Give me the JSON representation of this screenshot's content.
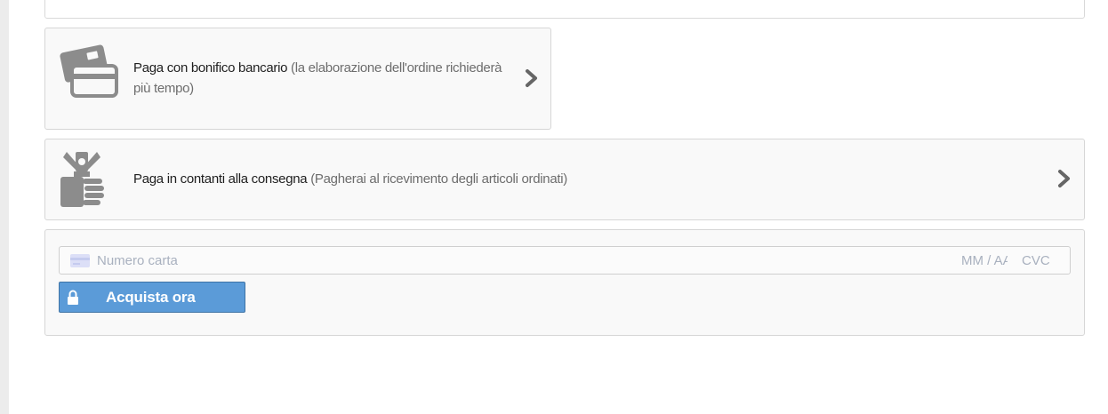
{
  "payment_options": [
    {
      "icon": "credit-card-icon",
      "title": "Paga con bonifico bancario",
      "description": "(la elaborazione dell'ordine richiederà più tempo)"
    },
    {
      "icon": "cash-hand-icon",
      "title": "Paga in contanti alla consegna",
      "description": "(Pagherai al ricevimento degli articoli ordinati)"
    }
  ],
  "card_form": {
    "number_placeholder": "Numero carta",
    "expiry_placeholder": "MM / AA",
    "cvc_placeholder": "CVC",
    "submit_label": "Acquista ora"
  },
  "colors": {
    "button": "#5b9bd8",
    "icon_gray": "#8c8c8c"
  }
}
